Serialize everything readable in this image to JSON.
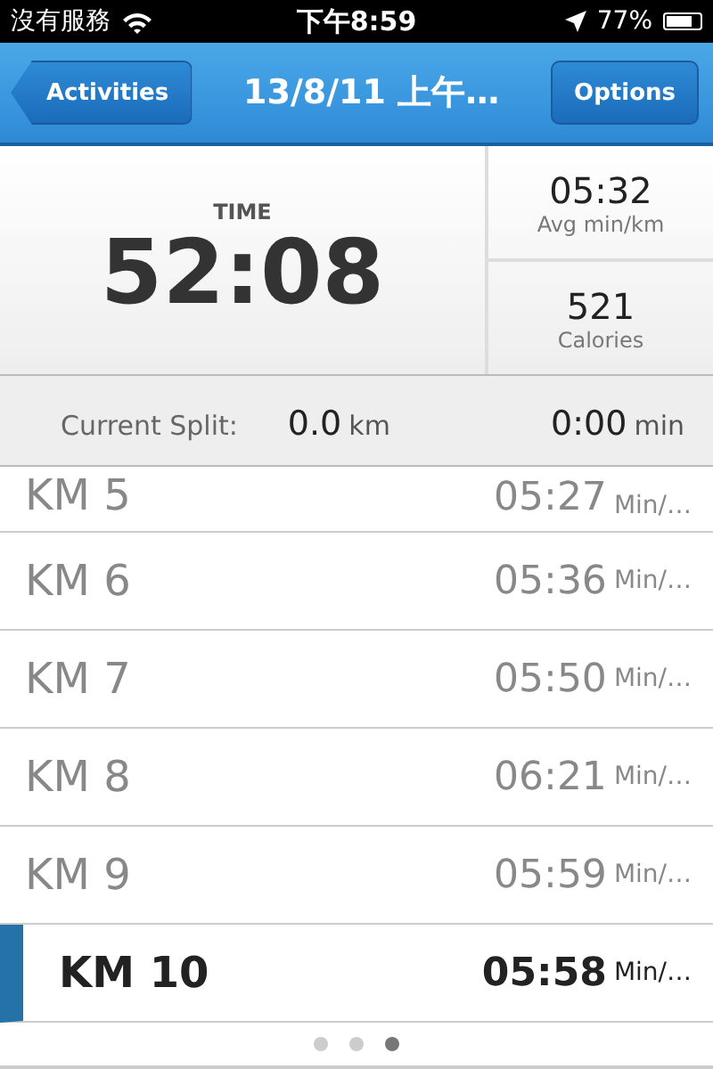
{
  "status_bar": {
    "carrier": "沒有服務",
    "time": "下午8:59",
    "battery": "77%"
  },
  "nav": {
    "back": "Activities",
    "title": "13/8/11 上午…",
    "action": "Options"
  },
  "stats": {
    "time_label": "TIME",
    "time": "52:08",
    "pace": "05:32",
    "pace_label": "Avg min/km",
    "calories": "521",
    "calories_label": "Calories"
  },
  "split": {
    "label": "Current Split:",
    "distance": "0.0",
    "distance_unit": "km",
    "duration": "0:00",
    "duration_unit": "min"
  },
  "splits": [
    {
      "km": "KM 5",
      "pace": "05:27",
      "unit": "Min/…",
      "selected": false
    },
    {
      "km": "KM 6",
      "pace": "05:36",
      "unit": "Min/…",
      "selected": false
    },
    {
      "km": "KM 7",
      "pace": "05:50",
      "unit": "Min/…",
      "selected": false
    },
    {
      "km": "KM 8",
      "pace": "06:21",
      "unit": "Min/…",
      "selected": false
    },
    {
      "km": "KM 9",
      "pace": "05:59",
      "unit": "Min/…",
      "selected": false
    },
    {
      "km": "KM 10",
      "pace": "05:58",
      "unit": "Min/…",
      "selected": true
    }
  ],
  "pages": [
    {
      "selected": false
    },
    {
      "selected": false
    },
    {
      "selected": true
    }
  ]
}
